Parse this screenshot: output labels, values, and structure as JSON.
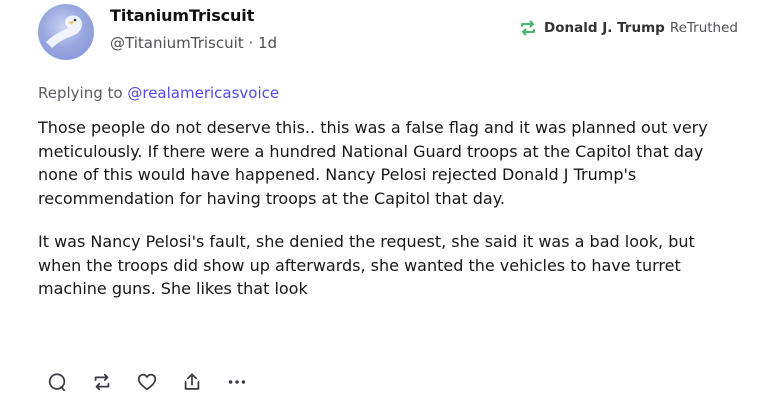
{
  "post": {
    "author": {
      "display_name": "TitaniumTriscuit",
      "handle": "@TitaniumTriscuit",
      "separator": "·",
      "time_ago": "1d",
      "avatar_icon": "eagle-avatar"
    },
    "retruth": {
      "icon": "retruth-icon",
      "name": "Donald J. Trump",
      "label": "ReTruthed"
    },
    "reply": {
      "prefix": "Replying to",
      "mention": "@realamericasvoice"
    },
    "paragraphs": [
      "Those people do not deserve this.. this was a false flag and it was planned out very meticulously. If there were a hundred National Guard troops at the Capitol that day none of this would have happened. Nancy Pelosi rejected Donald J Trump's recommendation for having troops at the Capitol that day.",
      "It was Nancy Pelosi's fault, she denied the request, she said it was a bad look, but when the troops did show up afterwards, she wanted the vehicles to have turret machine guns. She likes that look"
    ],
    "actions": [
      "reply-icon",
      "retruth-icon",
      "like-icon",
      "share-icon",
      "more-icon"
    ]
  },
  "colors": {
    "mention": "#5448ee",
    "secondary_text": "#505058",
    "body_text": "#17171c"
  }
}
